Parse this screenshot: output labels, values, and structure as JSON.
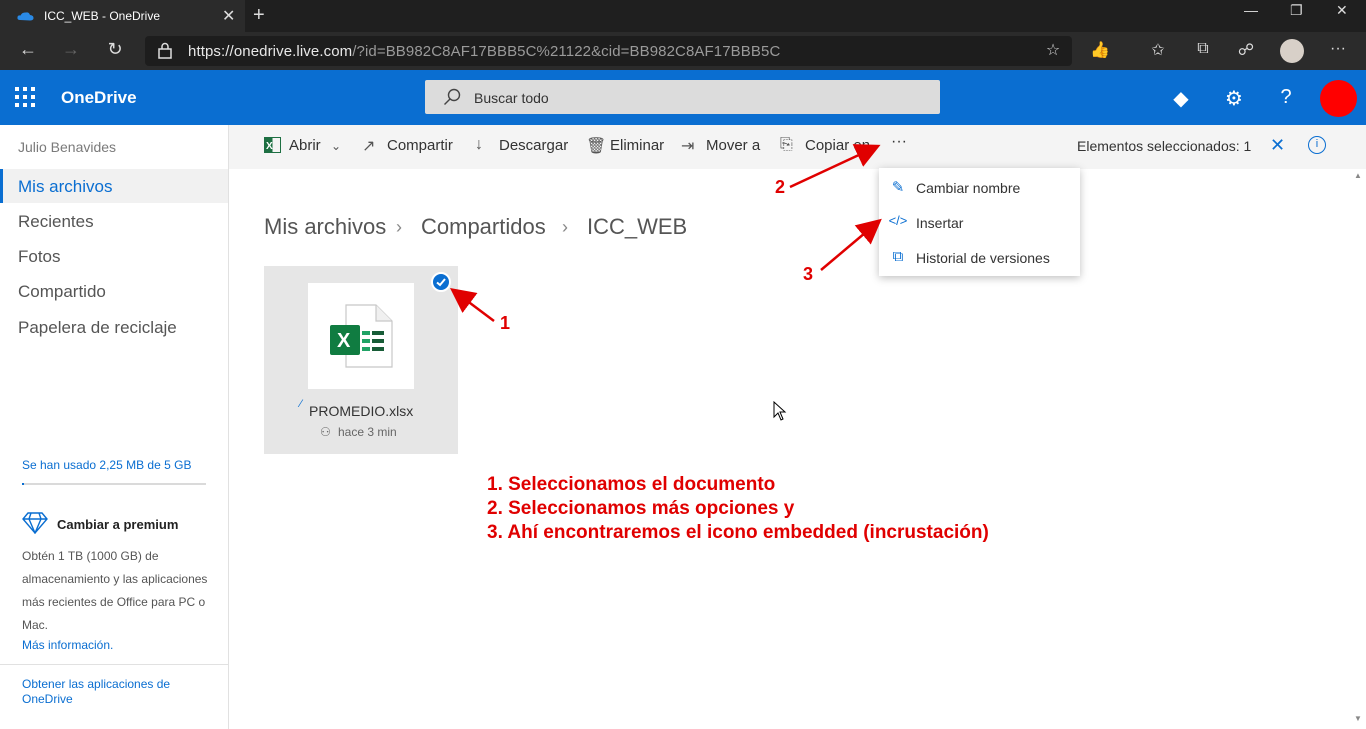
{
  "browser": {
    "tab_title": "ICC_WEB - OneDrive",
    "url_host": "https://onedrive.live.com",
    "url_rest": "/?id=BB982C8AF17BBB5C%21122&cid=BB982C8AF17BBB5C"
  },
  "header": {
    "app_name": "OneDrive",
    "search_placeholder": "Buscar todo"
  },
  "sidebar": {
    "user_name": "Julio Benavides",
    "items": [
      {
        "label": "Mis archivos"
      },
      {
        "label": "Recientes"
      },
      {
        "label": "Fotos"
      },
      {
        "label": "Compartido"
      },
      {
        "label": "Papelera de reciclaje"
      }
    ],
    "storage_text": "Se han usado 2,25 MB de 5 GB",
    "storage_used_fraction": 0.0005,
    "premium_title": "Cambiar a premium",
    "premium_text": "Obtén 1 TB (1000 GB) de almacenamiento y las aplicaciones más recientes de Office para PC o Mac.",
    "more_info": "Más información.",
    "get_apps": "Obtener las aplicaciones de OneDrive"
  },
  "commands": {
    "open": "Abrir",
    "share": "Compartir",
    "download": "Descargar",
    "delete": "Eliminar",
    "move": "Mover a",
    "copy": "Copiar en",
    "more": "···",
    "selected": "Elementos seleccionados: 1"
  },
  "breadcrumb": [
    "Mis archivos",
    "Compartidos",
    "ICC_WEB"
  ],
  "file": {
    "name": "PROMEDIO.xlsx",
    "modified": "hace 3 min"
  },
  "menu": {
    "rename": "Cambiar nombre",
    "embed": "Insertar",
    "versions": "Historial de versiones"
  },
  "annotations": {
    "n1": "1",
    "n2": "2",
    "n3": "3",
    "line1": "1. Seleccionamos el documento",
    "line2": "2. Seleccionamos más opciones y",
    "line3": "3. Ahí encontraremos el icono embedded (incrustación)"
  },
  "colors": {
    "brand_blue": "#0a6ed1",
    "annotation_red": "#e00000"
  }
}
